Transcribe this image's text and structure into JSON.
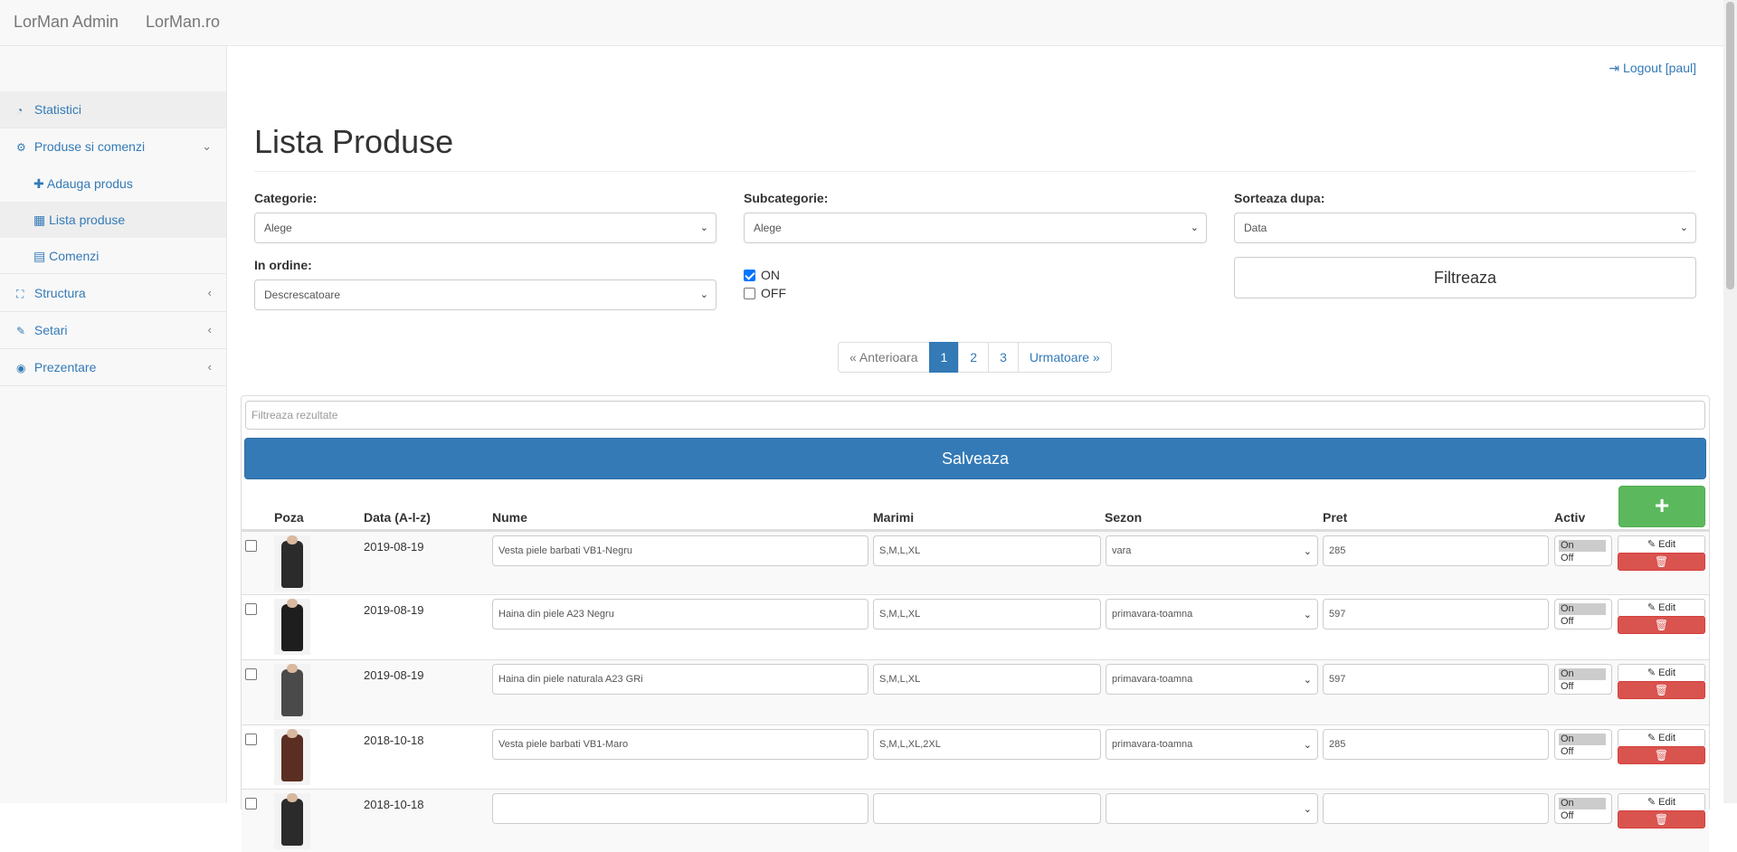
{
  "navbar": {
    "brand": "LorMan Admin",
    "site_link": "LorMan.ro"
  },
  "sidebar": {
    "items": [
      {
        "label": "Statistici",
        "icon": "dashboard-icon"
      },
      {
        "label": "Produse si comenzi",
        "icon": "cubes-icon",
        "expanded": true
      },
      {
        "label": "Adauga produs",
        "icon": "plus-icon",
        "sub": true
      },
      {
        "label": "Lista produse",
        "icon": "table-icon",
        "sub": true,
        "active": true
      },
      {
        "label": "Comenzi",
        "icon": "file-icon",
        "sub": true
      },
      {
        "label": "Structura",
        "icon": "sitemap-icon"
      },
      {
        "label": "Setari",
        "icon": "wrench-icon"
      },
      {
        "label": "Prezentare",
        "icon": "eye-icon"
      }
    ]
  },
  "header": {
    "logout": "Logout [paul]"
  },
  "page": {
    "title": "Lista Produse"
  },
  "filters": {
    "categorie_label": "Categorie:",
    "categorie_value": "Alege",
    "subcategorie_label": "Subcategorie:",
    "subcategorie_value": "Alege",
    "sorteaza_label": "Sorteaza dupa:",
    "sorteaza_value": "Data",
    "ordine_label": "In ordine:",
    "ordine_value": "Descrescatoare",
    "on_label": "ON",
    "on_checked": true,
    "off_label": "OFF",
    "off_checked": false,
    "filter_button": "Filtreaza"
  },
  "pagination": {
    "prev": "« Anterioara",
    "pages": [
      "1",
      "2",
      "3"
    ],
    "current": "1",
    "next": "Urmatoare »"
  },
  "table": {
    "search_placeholder": "Filtreaza rezultate",
    "save_button": "Salveaza",
    "add_button": "+",
    "columns": [
      "Poza",
      "Data (A-l-z)",
      "Nume",
      "Marimi",
      "Sezon",
      "Pret",
      "Activ"
    ],
    "toggle_on": "On",
    "toggle_off": "Off",
    "edit_label": "Edit",
    "rows": [
      {
        "date": "2019-08-19",
        "name": "Vesta piele barbati VB1-Negru",
        "sizes": "S,M,L,XL",
        "season": "vara",
        "price": "285",
        "color": "#2b2b2b"
      },
      {
        "date": "2019-08-19",
        "name": "Haina din piele A23 Negru",
        "sizes": "S,M,L,XL",
        "season": "primavara-toamna",
        "price": "597",
        "color": "#1e1e1e"
      },
      {
        "date": "2019-08-19",
        "name": "Haina din piele naturala A23 GRi",
        "sizes": "S,M,L,XL",
        "season": "primavara-toamna",
        "price": "597",
        "color": "#4a4a4a"
      },
      {
        "date": "2018-10-18",
        "name": "Vesta piele barbati VB1-Maro",
        "sizes": "S,M,L,XL,2XL",
        "season": "primavara-toamna",
        "price": "285",
        "color": "#5a2e22"
      },
      {
        "date": "2018-10-18",
        "name": "",
        "sizes": "",
        "season": "",
        "price": "",
        "color": "#2b2b2b"
      }
    ]
  }
}
